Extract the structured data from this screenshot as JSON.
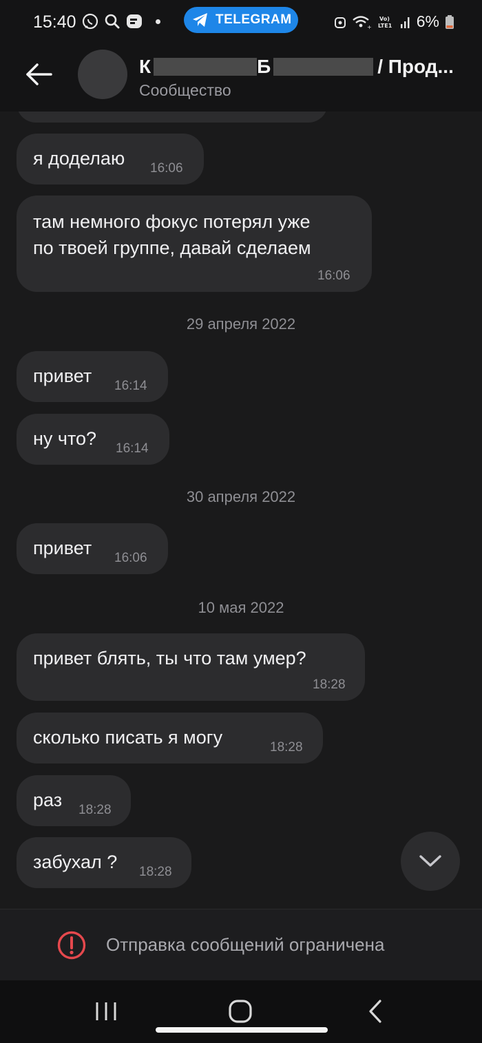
{
  "status_bar": {
    "time": "15:40",
    "icons": [
      "viber-icon",
      "search-icon",
      "notification-icon",
      "dot"
    ],
    "telegram_pill": "TELEGRAM",
    "right_icons": [
      "alarm-icon",
      "wifi-icon",
      "volte-icon",
      "signal-icon"
    ],
    "battery_text": "6%",
    "colors": {
      "pill": "#1e86e8",
      "battery_low": "#e0683a"
    }
  },
  "header": {
    "title_prefix": "К",
    "title_middle": "Б",
    "title_suffix": "/ Прод...",
    "subtitle": "Сообщество"
  },
  "messages": [
    {
      "type": "bubble",
      "text": "я доделаю",
      "time": "16:06"
    },
    {
      "type": "bubble",
      "lines": [
        "там немного фокус потерял уже",
        "по твоей группе, давай сделаем"
      ],
      "time": "16:06"
    },
    {
      "type": "date",
      "text": "29 апреля 2022"
    },
    {
      "type": "bubble",
      "text": "привет",
      "time": "16:14"
    },
    {
      "type": "bubble",
      "text": "ну что?",
      "time": "16:14"
    },
    {
      "type": "date",
      "text": "30 апреля 2022"
    },
    {
      "type": "bubble",
      "text": "привет",
      "time": "16:06"
    },
    {
      "type": "date",
      "text": "10 мая 2022"
    },
    {
      "type": "bubble",
      "text": "привет блять, ты что там умер?",
      "time": "18:28"
    },
    {
      "type": "bubble",
      "text": "сколько писать я могу",
      "time": "18:28"
    },
    {
      "type": "bubble",
      "text": "раз",
      "time": "18:28"
    },
    {
      "type": "bubble",
      "text": "забухал ?",
      "time": "18:28"
    }
  ],
  "restricted": {
    "text": "Отправка сообщений ограничена",
    "icon": "alert-circle-icon",
    "icon_color": "#e5484d"
  },
  "nav": [
    "recent-apps-icon",
    "home-icon",
    "back-icon"
  ]
}
